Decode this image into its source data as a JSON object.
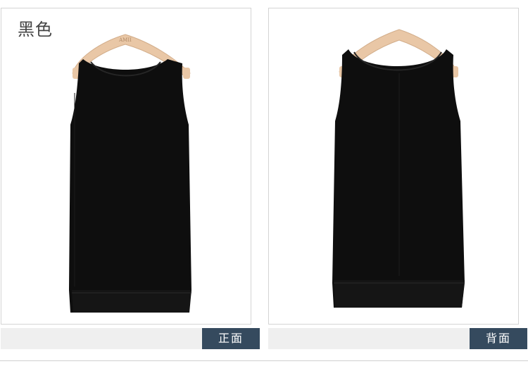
{
  "color_label": "黑色",
  "hanger_brand": "AMII",
  "captions": {
    "front": "正面",
    "back": "背面"
  },
  "colors": {
    "garment": "#0e0e0e",
    "hanger": "#e9c7a6",
    "caption_bg": "#354a5e",
    "caption_bar": "#efefef"
  }
}
